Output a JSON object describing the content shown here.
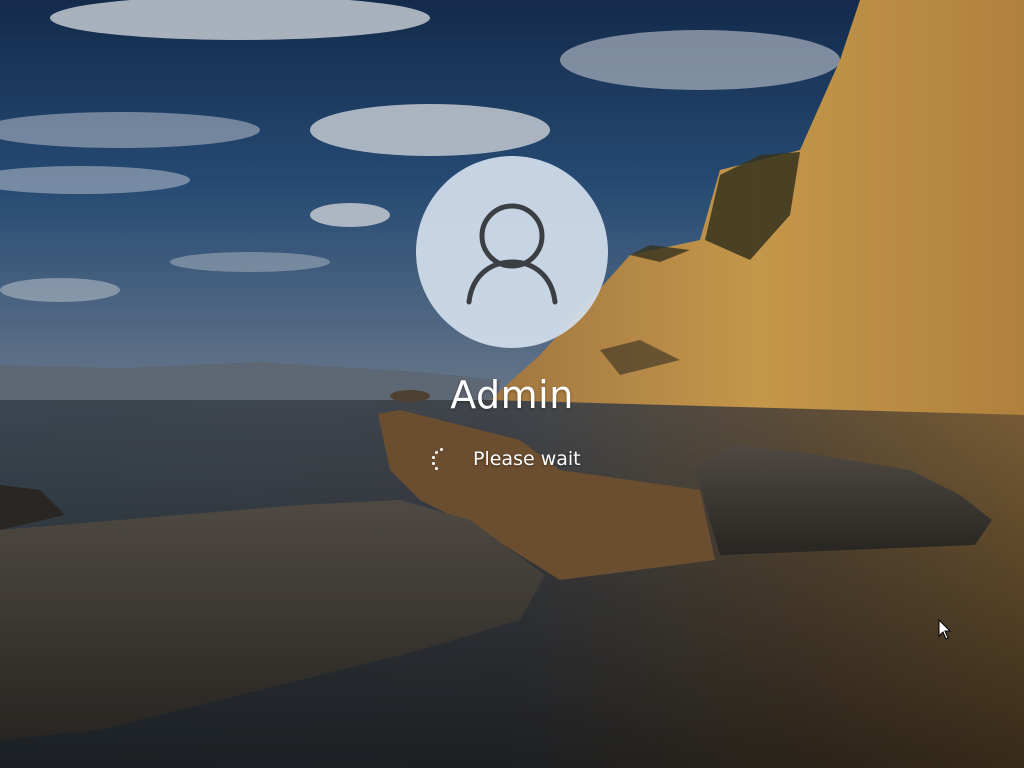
{
  "lock_screen": {
    "username": "Admin",
    "status": "Please wait"
  },
  "icons": {
    "avatar": "user-silhouette-icon",
    "spinner": "loading-dots-icon",
    "cursor": "mouse-pointer-icon"
  },
  "colors": {
    "sky": "#1d3a64",
    "cliff": "#d9a24a",
    "water": "#3a4450",
    "avatar_bg": "#d2deeb",
    "avatar_glyph": "#3b3f44",
    "text": "#ffffff"
  }
}
